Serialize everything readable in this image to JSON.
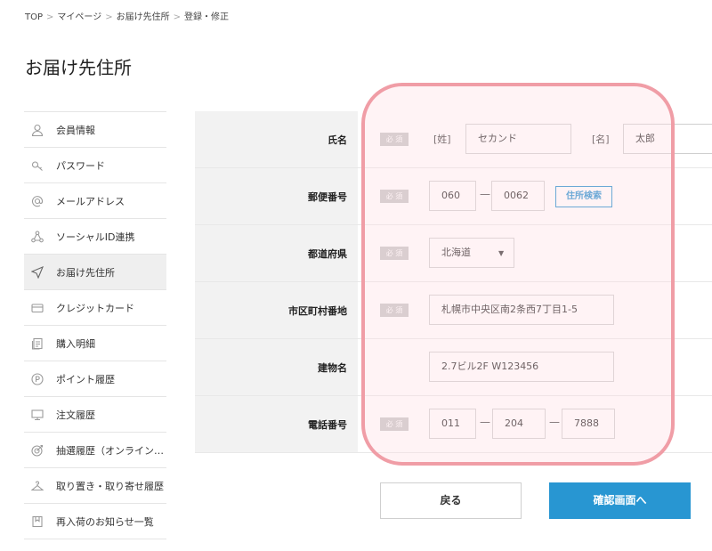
{
  "breadcrumb": {
    "items": [
      "TOP",
      "マイページ",
      "お届け先住所",
      "登録・修正"
    ],
    "separator": ">"
  },
  "page": {
    "title": "お届け先住所"
  },
  "sidebar": {
    "items": [
      {
        "label": "会員情報",
        "icon": "user-icon"
      },
      {
        "label": "パスワード",
        "icon": "key-icon"
      },
      {
        "label": "メールアドレス",
        "icon": "at-icon"
      },
      {
        "label": "ソーシャルID連携",
        "icon": "share-icon"
      },
      {
        "label": "お届け先住所",
        "icon": "send-icon",
        "active": true
      },
      {
        "label": "クレジットカード",
        "icon": "credit-card-icon"
      },
      {
        "label": "購入明細",
        "icon": "receipt-icon"
      },
      {
        "label": "ポイント履歴",
        "icon": "point-icon"
      },
      {
        "label": "注文履歴",
        "icon": "monitor-icon"
      },
      {
        "label": "抽選履歴（オンライン…",
        "icon": "target-icon"
      },
      {
        "label": "取り置き・取り寄せ履歴",
        "icon": "hanger-icon"
      },
      {
        "label": "再入荷のお知らせ一覧",
        "icon": "bookmark-icon"
      }
    ]
  },
  "form": {
    "required_badge": "必 須",
    "name": {
      "label": "氏名",
      "last_bracket": "[姓]",
      "last_value": "セカンド",
      "first_bracket": "[名]",
      "first_value": "太郎"
    },
    "postal": {
      "label": "郵便番号",
      "part1": "060",
      "dash": "—",
      "part2": "0062",
      "search_label": "住所検索"
    },
    "prefecture": {
      "label": "都道府県",
      "value": "北海道",
      "caret": "▼"
    },
    "city": {
      "label": "市区町村番地",
      "value": "札幌市中央区南2条西7丁目1-5"
    },
    "building": {
      "label": "建物名",
      "value": "2.7ビル2F W123456"
    },
    "phone": {
      "label": "電話番号",
      "part1": "011",
      "part2": "204",
      "part3": "7888",
      "dash": "—"
    }
  },
  "buttons": {
    "back": "戻る",
    "confirm": "確認画面へ"
  },
  "colors": {
    "accent": "#2896d2",
    "highlight": "#f09da6",
    "label_bg": "#f2f2f2",
    "required_bg": "#c6c6c6"
  }
}
